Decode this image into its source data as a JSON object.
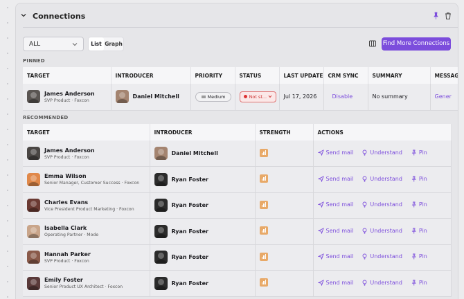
{
  "header": {
    "title": "Connections"
  },
  "toolbar": {
    "filter_value": "ALL",
    "view_list": "List",
    "view_graph": "Graph",
    "find_more": "Find More Connections"
  },
  "pinned": {
    "label": "PINNED",
    "columns": [
      "TARGET",
      "INTRODUCER",
      "PRIORITY",
      "STATUS",
      "LAST UPDATED",
      "CRM SYNC",
      "SUMMARY",
      "MESSAG"
    ],
    "row": {
      "target_name": "James Anderson",
      "target_sub": "SVP Product · Foxcon",
      "introducer": "Daniel Mitchell",
      "priority": "Medium",
      "status": "Not st...",
      "last_updated": "Jul 17, 2026",
      "crm_sync": "Disable",
      "summary": "No summary",
      "message": "Gener"
    }
  },
  "recommended": {
    "label": "RECOMMENDED",
    "columns": [
      "TARGET",
      "INTRODUCER",
      "STRENGTH",
      "ACTIONS"
    ],
    "actions": {
      "send": "Send mail",
      "understand": "Understand",
      "pin": "Pin"
    },
    "rows": [
      {
        "name": "James Anderson",
        "sub": "SVP Product · Foxcon",
        "introducer": "Daniel Mitchell"
      },
      {
        "name": "Emma Wilson",
        "sub": "Senior Manager, Customer Success · Foxcon",
        "introducer": "Ryan Foster"
      },
      {
        "name": "Charles Evans",
        "sub": "Vice President Product Marketing · Foxcon",
        "introducer": "Ryan Foster"
      },
      {
        "name": "Isabella Clark",
        "sub": "Operating Partner · Mode",
        "introducer": "Ryan Foster"
      },
      {
        "name": "Hannah Parker",
        "sub": "SVP Product · Foxcon",
        "introducer": "Ryan Foster"
      },
      {
        "name": "Emily Foster",
        "sub": "Senior Product UX Architect · Foxcon",
        "introducer": "Ryan Foster"
      }
    ]
  },
  "colors": {
    "accent": "#7c4ddc",
    "status_red": "#cc3333",
    "strength": "#e8a968"
  }
}
